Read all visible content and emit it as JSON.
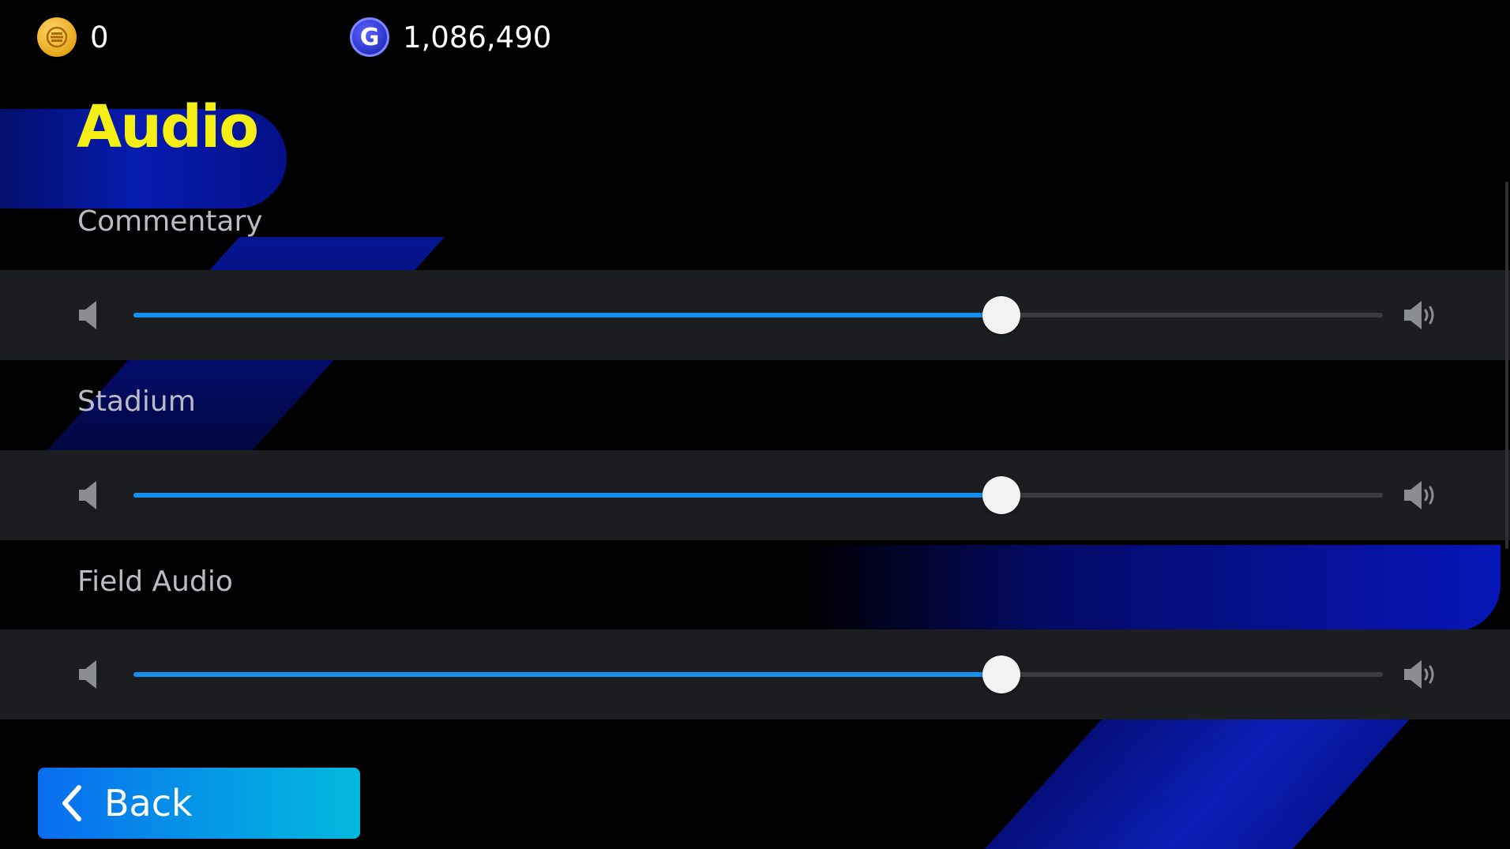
{
  "currencies": {
    "coins": {
      "icon": "coin-icon",
      "value": "0",
      "color": "#e8a51a"
    },
    "gp": {
      "icon": "gp-coin-icon",
      "glyph": "G",
      "value": "1,086,490",
      "color": "#2a33c8"
    }
  },
  "page": {
    "title": "Audio",
    "title_color": "#f4ee17"
  },
  "sliders": [
    {
      "label": "Commentary",
      "level": 0.695
    },
    {
      "label": "Stadium",
      "level": 0.695
    },
    {
      "label": "Field Audio",
      "level": 0.695
    }
  ],
  "colors": {
    "slider_fill": "#1590ef",
    "slider_track": "#3b3c42",
    "row_background": "#1c1d21",
    "back_button_start": "#0a6cf0",
    "back_button_end": "#03b9dd"
  },
  "footer": {
    "back_label": "Back",
    "back_icon": "chevron-left-icon"
  }
}
